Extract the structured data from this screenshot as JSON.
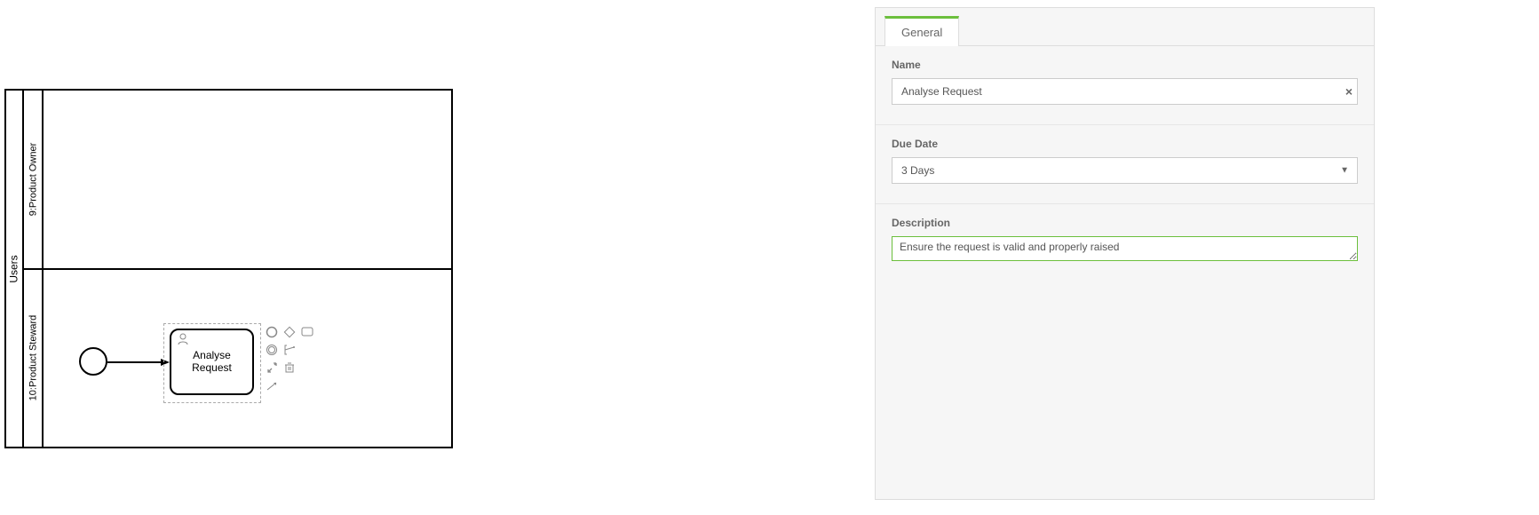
{
  "diagram": {
    "pool_label": "Users",
    "lanes": [
      {
        "label": "9:Product Owner"
      },
      {
        "label": "10:Product Steward"
      }
    ],
    "task_label": "Analyse Request"
  },
  "panel": {
    "tab_label": "General",
    "name": {
      "label": "Name",
      "value": "Analyse Request"
    },
    "due_date": {
      "label": "Due Date",
      "value": "3 Days"
    },
    "description": {
      "label": "Description",
      "value": "Ensure the request is valid and properly raised"
    }
  }
}
